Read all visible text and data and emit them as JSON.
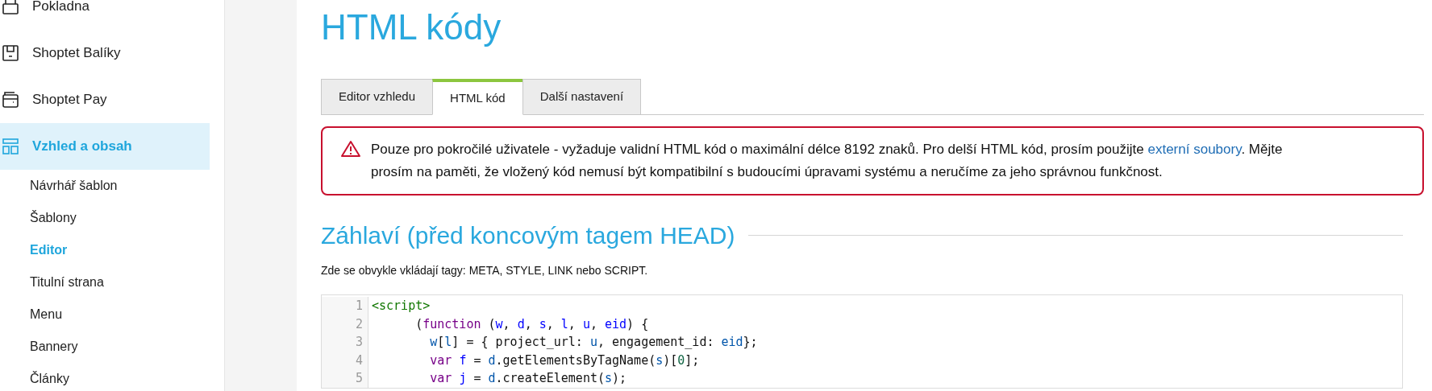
{
  "sidebar": {
    "items": [
      {
        "label": "Pokladna",
        "selected": false
      },
      {
        "label": "Shoptet Balíky",
        "selected": false
      },
      {
        "label": "Shoptet Pay",
        "selected": false
      },
      {
        "label": "Vzhled a obsah",
        "selected": true
      }
    ],
    "subitems": [
      {
        "label": "Návrhář šablon",
        "selected": false
      },
      {
        "label": "Šablony",
        "selected": false
      },
      {
        "label": "Editor",
        "selected": true
      },
      {
        "label": "Titulní strana",
        "selected": false
      },
      {
        "label": "Menu",
        "selected": false
      },
      {
        "label": "Bannery",
        "selected": false
      },
      {
        "label": "Články",
        "selected": false
      }
    ]
  },
  "page_title": "HTML kódy",
  "tabs": [
    {
      "label": "Editor vzhledu",
      "selected": false
    },
    {
      "label": "HTML kód",
      "selected": true
    },
    {
      "label": "Další nastavení",
      "selected": false
    }
  ],
  "alert": {
    "text": "Pouze pro pokročilé uživatele - vyžaduje validní HTML kód o maximální délce 8192 znaků. Pro delší HTML kód, prosím použijte",
    "link": "externí soubory",
    "text_after": ". Mějte prosím na paměti, že vložený kód nemusí být kompatibilní s budoucími úpravami systému a neručíme za jeho správnou funkčnost."
  },
  "section": {
    "heading": "Záhlaví (před koncovým tagem HEAD)",
    "description": "Zde se obvykle vkládají tagy: META, STYLE, LINK nebo SCRIPT."
  },
  "code": {
    "lines": [
      {
        "number": "1",
        "tokens": [
          {
            "kind": "tag",
            "text": "<script>"
          }
        ]
      },
      {
        "number": "2",
        "tokens": [
          {
            "kind": "plain",
            "text": "      ("
          },
          {
            "kind": "keyword",
            "text": "function"
          },
          {
            "kind": "plain",
            "text": " ("
          },
          {
            "kind": "def",
            "text": "w"
          },
          {
            "kind": "plain",
            "text": ", "
          },
          {
            "kind": "def",
            "text": "d"
          },
          {
            "kind": "plain",
            "text": ", "
          },
          {
            "kind": "def",
            "text": "s"
          },
          {
            "kind": "plain",
            "text": ", "
          },
          {
            "kind": "def",
            "text": "l"
          },
          {
            "kind": "plain",
            "text": ", "
          },
          {
            "kind": "def",
            "text": "u"
          },
          {
            "kind": "plain",
            "text": ", "
          },
          {
            "kind": "def",
            "text": "eid"
          },
          {
            "kind": "plain",
            "text": ") {"
          }
        ]
      },
      {
        "number": "3",
        "tokens": [
          {
            "kind": "var",
            "text": "        w"
          },
          {
            "kind": "plain",
            "text": "["
          },
          {
            "kind": "var",
            "text": "l"
          },
          {
            "kind": "plain",
            "text": "] = { project_url: "
          },
          {
            "kind": "var",
            "text": "u"
          },
          {
            "kind": "plain",
            "text": ", engagement_id: "
          },
          {
            "kind": "var",
            "text": "eid"
          },
          {
            "kind": "plain",
            "text": "};"
          }
        ]
      },
      {
        "number": "4",
        "tokens": [
          {
            "kind": "keyword",
            "text": "        var "
          },
          {
            "kind": "def",
            "text": "f"
          },
          {
            "kind": "plain",
            "text": " = "
          },
          {
            "kind": "var",
            "text": "d"
          },
          {
            "kind": "plain",
            "text": ".getElementsByTagName("
          },
          {
            "kind": "var",
            "text": "s"
          },
          {
            "kind": "plain",
            "text": ")["
          },
          {
            "kind": "number",
            "text": "0"
          },
          {
            "kind": "plain",
            "text": "];"
          }
        ]
      },
      {
        "number": "5",
        "tokens": [
          {
            "kind": "keyword",
            "text": "        var "
          },
          {
            "kind": "def",
            "text": "j"
          },
          {
            "kind": "plain",
            "text": " = "
          },
          {
            "kind": "var",
            "text": "d"
          },
          {
            "kind": "plain",
            "text": ".createElement("
          },
          {
            "kind": "var",
            "text": "s"
          },
          {
            "kind": "plain",
            "text": ");"
          }
        ]
      }
    ]
  }
}
